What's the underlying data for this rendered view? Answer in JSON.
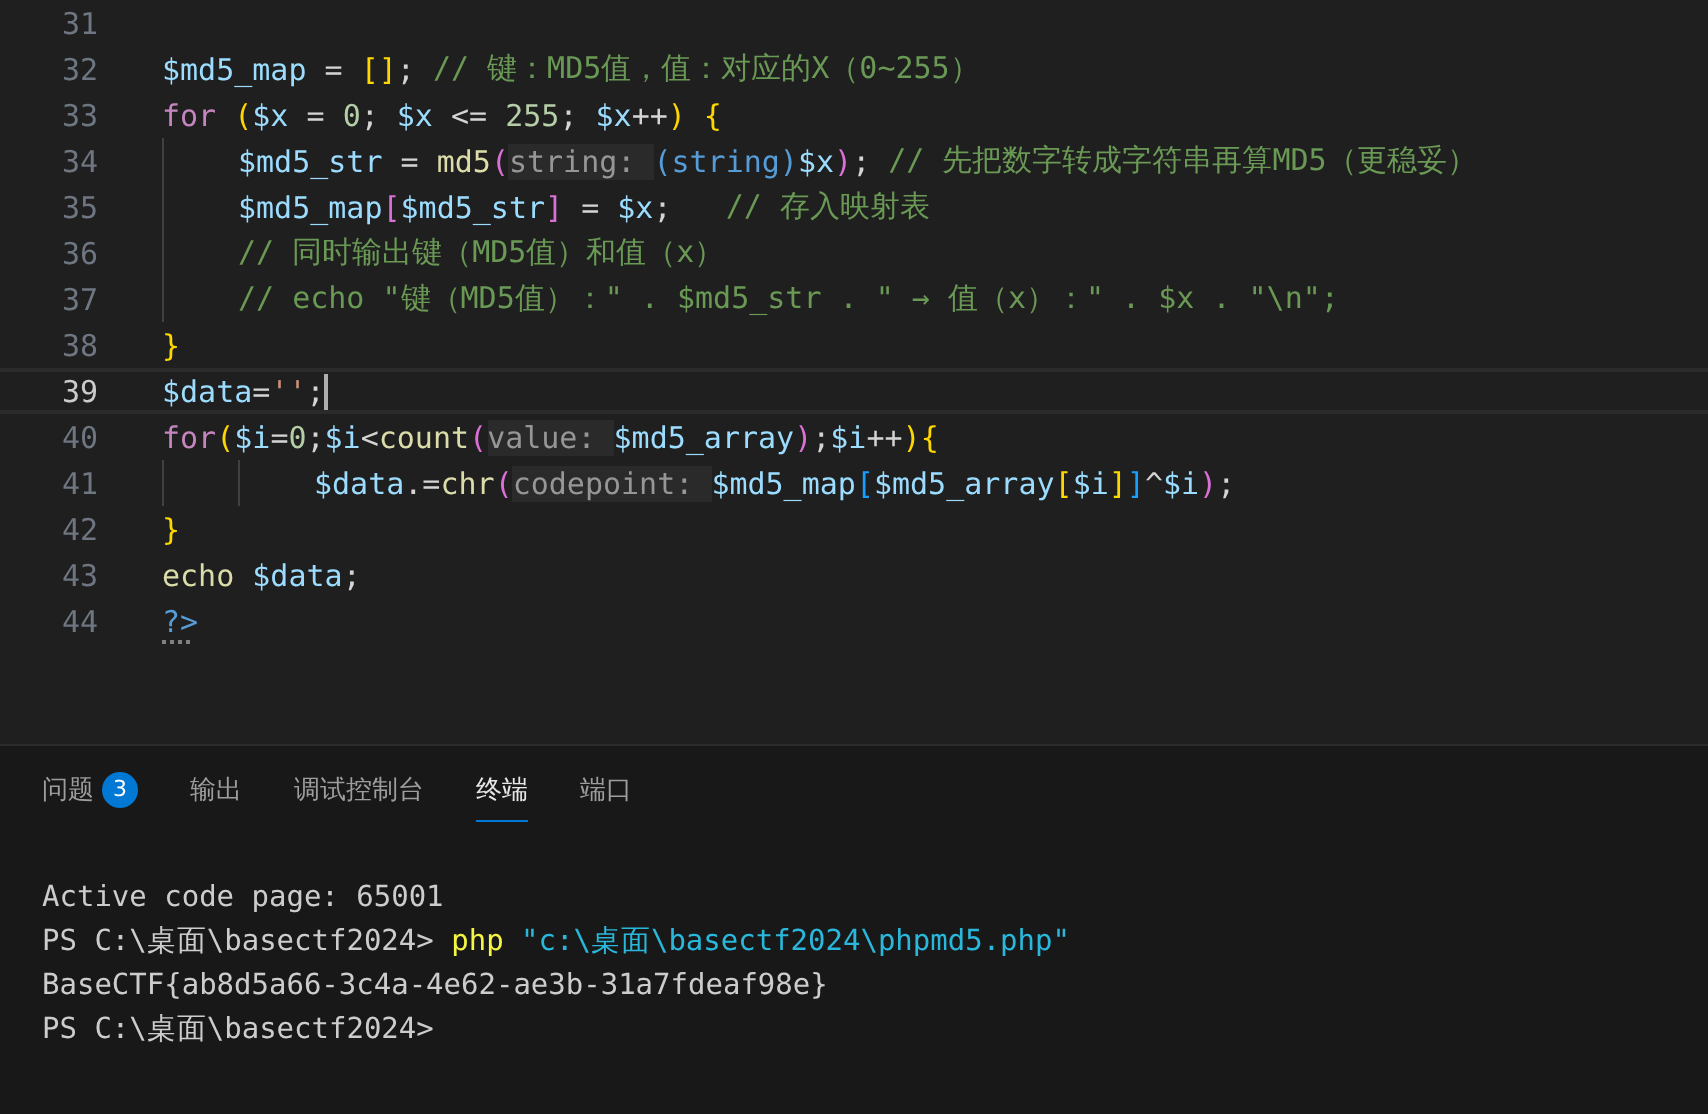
{
  "editor": {
    "lines": [
      {
        "number": "31",
        "current": false
      },
      {
        "number": "32",
        "current": false,
        "tokens": [
          {
            "kind": "var",
            "text": "$md5_map"
          },
          {
            "kind": "op",
            "text": " = "
          },
          {
            "kind": "b1",
            "text": "["
          },
          {
            "kind": "b1",
            "text": "]"
          },
          {
            "kind": "op",
            "text": "; "
          },
          {
            "kind": "comment",
            "text": "// 键：MD5值，值：对应的X（0~255）"
          }
        ]
      },
      {
        "number": "33",
        "current": false,
        "tokens": [
          {
            "kind": "kw",
            "text": "for"
          },
          {
            "kind": "b1",
            "text": " ("
          },
          {
            "kind": "var",
            "text": "$x"
          },
          {
            "kind": "op",
            "text": " = "
          },
          {
            "kind": "num",
            "text": "0"
          },
          {
            "kind": "op",
            "text": "; "
          },
          {
            "kind": "var",
            "text": "$x"
          },
          {
            "kind": "op",
            "text": " <= "
          },
          {
            "kind": "num",
            "text": "255"
          },
          {
            "kind": "op",
            "text": "; "
          },
          {
            "kind": "var",
            "text": "$x"
          },
          {
            "kind": "op",
            "text": "++"
          },
          {
            "kind": "b1",
            "text": ")"
          },
          {
            "kind": "b1",
            "text": " {"
          }
        ],
        "children": [
          {
            "number": "34",
            "current": false,
            "tokens": [
              {
                "kind": "var",
                "text": "$md5_str"
              },
              {
                "kind": "op",
                "text": " = "
              },
              {
                "kind": "fn",
                "text": "md5"
              },
              {
                "kind": "b2",
                "text": "("
              },
              {
                "kind": "hint",
                "text": "string: "
              },
              {
                "kind": "cast",
                "text": "(string)"
              },
              {
                "kind": "var",
                "text": "$x"
              },
              {
                "kind": "b2",
                "text": ")"
              },
              {
                "kind": "op",
                "text": "; "
              },
              {
                "kind": "comment",
                "text": "// 先把数字转成字符串再算MD5（更稳妥）"
              }
            ]
          },
          {
            "number": "35",
            "current": false,
            "tokens": [
              {
                "kind": "var",
                "text": "$md5_map"
              },
              {
                "kind": "b2",
                "text": "["
              },
              {
                "kind": "var",
                "text": "$md5_str"
              },
              {
                "kind": "b2",
                "text": "]"
              },
              {
                "kind": "op",
                "text": " = "
              },
              {
                "kind": "var",
                "text": "$x"
              },
              {
                "kind": "op",
                "text": ";   "
              },
              {
                "kind": "comment",
                "text": "// 存入映射表"
              }
            ]
          },
          {
            "number": "36",
            "current": false,
            "tokens": [
              {
                "kind": "comment",
                "text": "// 同时输出键（MD5值）和值（x）"
              }
            ]
          },
          {
            "number": "37",
            "current": false,
            "tokens": [
              {
                "kind": "comment",
                "text": "// echo \"键（MD5值）：\" . $md5_str . \" → 值（x）：\" . $x . \"\\n\";"
              }
            ]
          }
        ]
      },
      {
        "number": "38",
        "current": false,
        "tokens": [
          {
            "kind": "b1",
            "text": "}"
          }
        ]
      },
      {
        "number": "39",
        "current": true,
        "tokens": [
          {
            "kind": "var",
            "text": "$data"
          },
          {
            "kind": "op",
            "text": "="
          },
          {
            "kind": "string",
            "text": "''"
          },
          {
            "kind": "op",
            "text": ";"
          }
        ]
      },
      {
        "number": "40",
        "current": false,
        "tokens": [
          {
            "kind": "kw",
            "text": "for"
          },
          {
            "kind": "b1",
            "text": "("
          },
          {
            "kind": "var",
            "text": "$i"
          },
          {
            "kind": "op",
            "text": "="
          },
          {
            "kind": "num",
            "text": "0"
          },
          {
            "kind": "op",
            "text": ";"
          },
          {
            "kind": "var",
            "text": "$i"
          },
          {
            "kind": "op",
            "text": "<"
          },
          {
            "kind": "fn",
            "text": "count"
          },
          {
            "kind": "b2",
            "text": "("
          },
          {
            "kind": "hint",
            "text": "value: "
          },
          {
            "kind": "var",
            "text": "$md5_array"
          },
          {
            "kind": "b2",
            "text": ")"
          },
          {
            "kind": "op",
            "text": ";"
          },
          {
            "kind": "var",
            "text": "$i"
          },
          {
            "kind": "op",
            "text": "++"
          },
          {
            "kind": "b1",
            "text": ")"
          },
          {
            "kind": "b1",
            "text": "{"
          }
        ],
        "children": [
          {
            "number": "41",
            "current": false,
            "extra_indent": true,
            "tokens": [
              {
                "kind": "var",
                "text": "$data"
              },
              {
                "kind": "op",
                "text": ".="
              },
              {
                "kind": "fn",
                "text": "chr"
              },
              {
                "kind": "b2",
                "text": "("
              },
              {
                "kind": "hint",
                "text": "codepoint: "
              },
              {
                "kind": "var",
                "text": "$md5_map"
              },
              {
                "kind": "b3",
                "text": "["
              },
              {
                "kind": "var",
                "text": "$md5_array"
              },
              {
                "kind": "b1",
                "text": "["
              },
              {
                "kind": "var",
                "text": "$i"
              },
              {
                "kind": "b1",
                "text": "]"
              },
              {
                "kind": "b3",
                "text": "]"
              },
              {
                "kind": "op",
                "text": "^"
              },
              {
                "kind": "var",
                "text": "$i"
              },
              {
                "kind": "b2",
                "text": ")"
              },
              {
                "kind": "op",
                "text": ";"
              }
            ]
          }
        ]
      },
      {
        "number": "42",
        "current": false,
        "tokens": [
          {
            "kind": "b1",
            "text": "}"
          }
        ]
      },
      {
        "number": "43",
        "current": false,
        "tokens": [
          {
            "kind": "fn",
            "text": "echo "
          },
          {
            "kind": "var",
            "text": "$data"
          },
          {
            "kind": "op",
            "text": ";"
          }
        ]
      },
      {
        "number": "44",
        "current": false,
        "tokens": [
          {
            "kind": "tag",
            "text": "?>"
          }
        ]
      }
    ]
  },
  "panel": {
    "tabs": [
      {
        "label": "问题",
        "badge": "3",
        "selected": false
      },
      {
        "label": "输出",
        "selected": false
      },
      {
        "label": "调试控制台",
        "selected": false
      },
      {
        "label": "终端",
        "selected": true
      },
      {
        "label": "端口",
        "selected": false
      }
    ],
    "terminal": [
      [
        {
          "kind": "out",
          "text": "Active code page: 65001"
        }
      ],
      [
        {
          "kind": "out",
          "text": "PS C:\\桌面\\basectf2024> "
        },
        {
          "kind": "cmd",
          "text": "php"
        },
        {
          "kind": "arg",
          "text": " \"c:\\桌面\\basectf2024\\phpmd5.php\""
        }
      ],
      [
        {
          "kind": "out",
          "text": "BaseCTF{ab8d5a66-3c4a-4e62-ae3b-31a7fdeaf98e}"
        }
      ],
      [
        {
          "kind": "out",
          "text": "PS C:\\桌面\\basectf2024>"
        }
      ]
    ]
  }
}
